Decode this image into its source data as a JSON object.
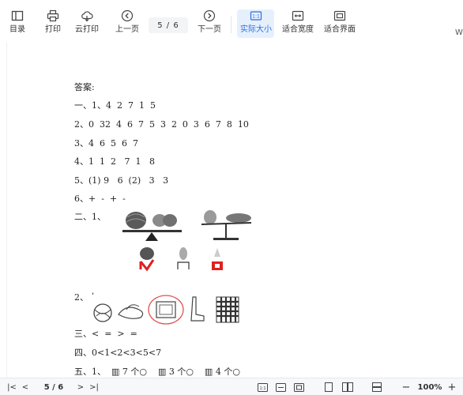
{
  "toolbar": {
    "items": [
      {
        "label": "目录",
        "icon": "sidebar-icon"
      },
      {
        "label": "打印",
        "icon": "printer-icon"
      },
      {
        "label": "云打印",
        "icon": "cloud-print-icon"
      },
      {
        "label": "上一页",
        "icon": "chevron-left-circle-icon"
      },
      {
        "label": "下一页",
        "icon": "chevron-right-circle-icon"
      },
      {
        "label": "实际大小",
        "icon": "actual-size-icon",
        "active": true
      },
      {
        "label": "适合宽度",
        "icon": "fit-width-icon"
      },
      {
        "label": "适合界面",
        "icon": "fit-page-icon"
      }
    ],
    "page_indicator": "5 / 6",
    "cut_off_text": "W",
    "accent_color": "#2a6fe0"
  },
  "document": {
    "lines": [
      "答案:",
      "一、1、4  2  7  1  5",
      "2、0  32  4  6  7  5  3  2  0  3  6  7  8  10",
      "3、4  6  5  6  7",
      "4、1  1  2   7  1   8",
      "5、(1) 9   6  (2)   3   3",
      "6、+  -  +  -",
      "二、1、",
      "2、",
      "三、<  =  >  =",
      "四、0<1<2<3<5<7",
      "五、1、  ▥ 7 个○    ▥ 3 个○    ▥ 4 个○"
    ],
    "figures": [
      {
        "name": "balance-scale-figure",
        "description": "watermelon vs fruits balance scales with answers"
      },
      {
        "name": "items-figure",
        "description": "ball, shoes, box circled, socks, checkered bag"
      }
    ]
  },
  "bottombar": {
    "first_page": "|<",
    "prev_page": "<",
    "page_indicator": "5 / 6",
    "next_page": ">",
    "last_page": ">|",
    "zoom_minus": "−",
    "zoom_value": "100%",
    "zoom_plus": "+"
  }
}
